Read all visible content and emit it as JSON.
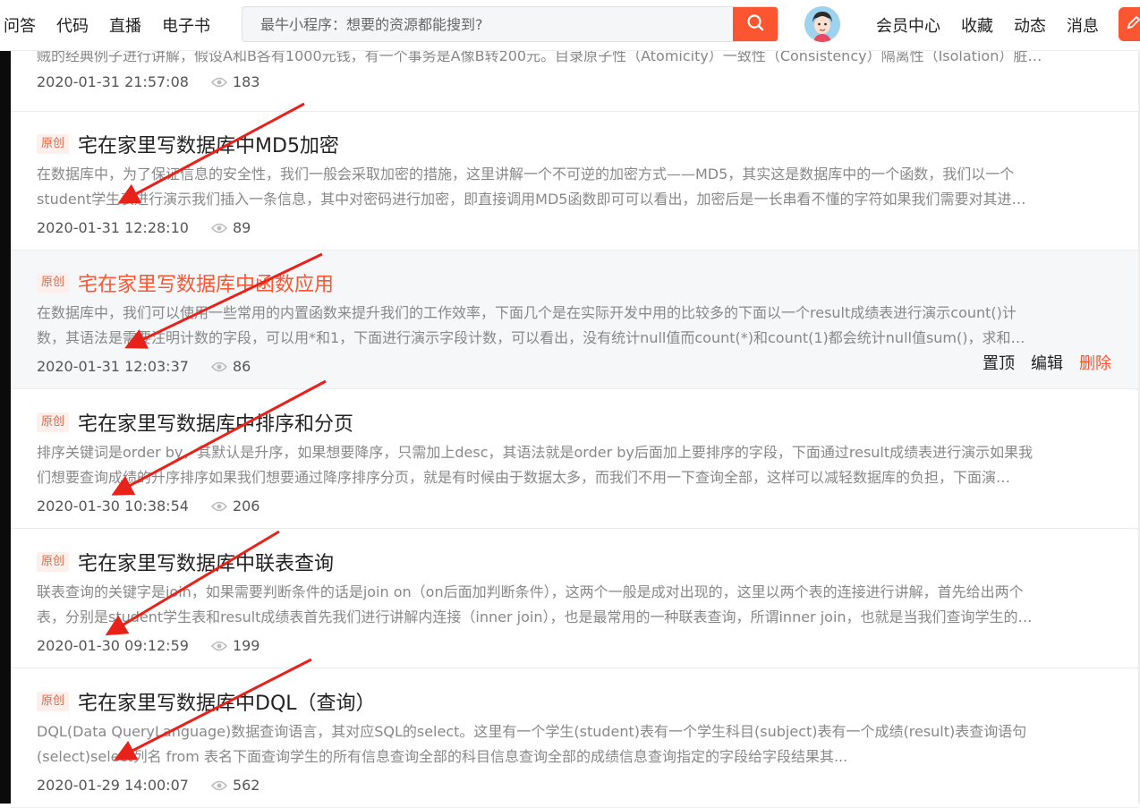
{
  "header": {
    "nav": [
      "问答",
      "代码",
      "直播",
      "电子书"
    ],
    "search_placeholder": "最牛小程序：想要的资源都能搜到?",
    "right_nav": [
      "会员中心",
      "收藏",
      "动态",
      "消息"
    ],
    "accent_color": "#fc5531"
  },
  "partial_article": {
    "desc": "贼的经典例子进行讲解，假设A和B各有1000元钱，有一个事务是A像B转200元。目录原子性（Atomicity）一致性（Consistency）隔离性（Isolation）脏…",
    "date": "2020-01-31 21:57:08",
    "views": "183"
  },
  "articles": [
    {
      "badge": "原创",
      "title": "宅在家里写数据库中MD5加密",
      "desc1": "在数据库中，为了保证信息的安全性，我们一般会采取加密的措施，这里讲解一个不可逆的加密方式——MD5，其实这是数据库中的一个函数，我们以一个",
      "desc2": "student学生表进行演示我们插入一条信息，其中对密码进行加密，即直接调用MD5函数即可可以看出，加密后是一长串看不懂的字符如果我们需要对其进…",
      "date": "2020-01-31 12:28:10",
      "views": "89"
    },
    {
      "badge": "原创",
      "title": "宅在家里写数据库中函数应用",
      "desc1": "在数据库中，我们可以使用一些常用的内置函数来提升我们的工作效率，下面几个是在实际开发中用的比较多的下面以一个result成绩表进行演示count()计",
      "desc2": "数，其语法是需要注明计数的字段，可以用*和1，下面进行演示字段计数，可以看出，没有统计null值而count(*)和count(1)都会统计null值sum()，求和…",
      "date": "2020-01-31 12:03:37",
      "views": "86",
      "actions": [
        "置顶",
        "编辑",
        "删除"
      ]
    },
    {
      "badge": "原创",
      "title": "宅在家里写数据库中排序和分页",
      "desc1": "排序关键词是order by，其默认是升序，如果想要降序，只需加上desc，其语法就是order by后面加上要排序的字段，下面通过result成绩表进行演示如果我",
      "desc2": "们想要查询成绩的升序排序如果我们想要通过降序排序分页，就是有时候由于数据太多，而我们不用一下查询全部，这样可以减轻数据库的负担，下面演…",
      "date": "2020-01-30 10:38:54",
      "views": "206"
    },
    {
      "badge": "原创",
      "title": "宅在家里写数据库中联表查询",
      "desc1": "联表查询的关键字是join，如果需要判断条件的话是join on（on后面加判断条件），这两个一般是成对出现的，这里以两个表的连接进行讲解，首先给出两个",
      "desc2": "表，分别是student学生表和result成绩表首先我们进行讲解内连接（inner join），也是最常用的一种联表查询，所谓inner join，也就是当我们查询学生的…",
      "date": "2020-01-30 09:12:59",
      "views": "199"
    },
    {
      "badge": "原创",
      "title": "宅在家里写数据库中DQL（查询）",
      "desc1": "DQL(Data QueryLanguage)数据查询语言，其对应SQL的select。这里有一个学生(student)表有一个学生科目(subject)表有一个成绩(result)表查询语句",
      "desc2": "(select)select列名 from 表名下面查询学生的所有信息查询全部的科目信息查询全部的成绩信息查询指定的字段给字段结果其...",
      "date": "2020-01-29 14:00:07",
      "views": "562"
    }
  ]
}
